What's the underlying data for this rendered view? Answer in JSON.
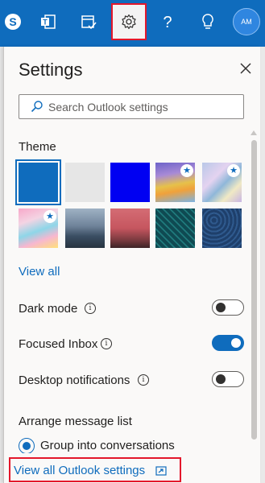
{
  "topbar": {
    "buttons": [
      {
        "name": "skype-icon"
      },
      {
        "name": "teams-icon"
      },
      {
        "name": "my-day-icon"
      },
      {
        "name": "gear-icon",
        "active": true
      },
      {
        "name": "help-icon"
      },
      {
        "name": "lightbulb-icon"
      }
    ],
    "avatar_initials": "AM"
  },
  "settings": {
    "title": "Settings",
    "search_placeholder": "Search Outlook settings",
    "theme": {
      "heading": "Theme",
      "swatches": [
        {
          "name": "blue",
          "selected": true,
          "premium": false
        },
        {
          "name": "light-gray",
          "selected": false,
          "premium": false
        },
        {
          "name": "bright-blue",
          "selected": false,
          "premium": false
        },
        {
          "name": "rainbow-wave",
          "selected": false,
          "premium": true
        },
        {
          "name": "prismatic",
          "selected": false,
          "premium": true
        },
        {
          "name": "unicorn",
          "selected": false,
          "premium": true
        },
        {
          "name": "mountain",
          "selected": false,
          "premium": false
        },
        {
          "name": "palm-sunset",
          "selected": false,
          "premium": false
        },
        {
          "name": "circuit",
          "selected": false,
          "premium": false
        },
        {
          "name": "innovation",
          "selected": false,
          "premium": false
        }
      ],
      "view_all": "View all"
    },
    "options": [
      {
        "label": "Dark mode",
        "on": false
      },
      {
        "label": "Focused Inbox",
        "on": true
      },
      {
        "label": "Desktop notifications",
        "on": false
      }
    ],
    "arrange": {
      "heading": "Arrange message list",
      "radio_label": "Group into conversations"
    },
    "footer_link": "View all Outlook settings"
  },
  "colors": {
    "accent": "#0f6cbd",
    "highlight": "#e3172b",
    "panel_bg": "#faf9f8"
  }
}
